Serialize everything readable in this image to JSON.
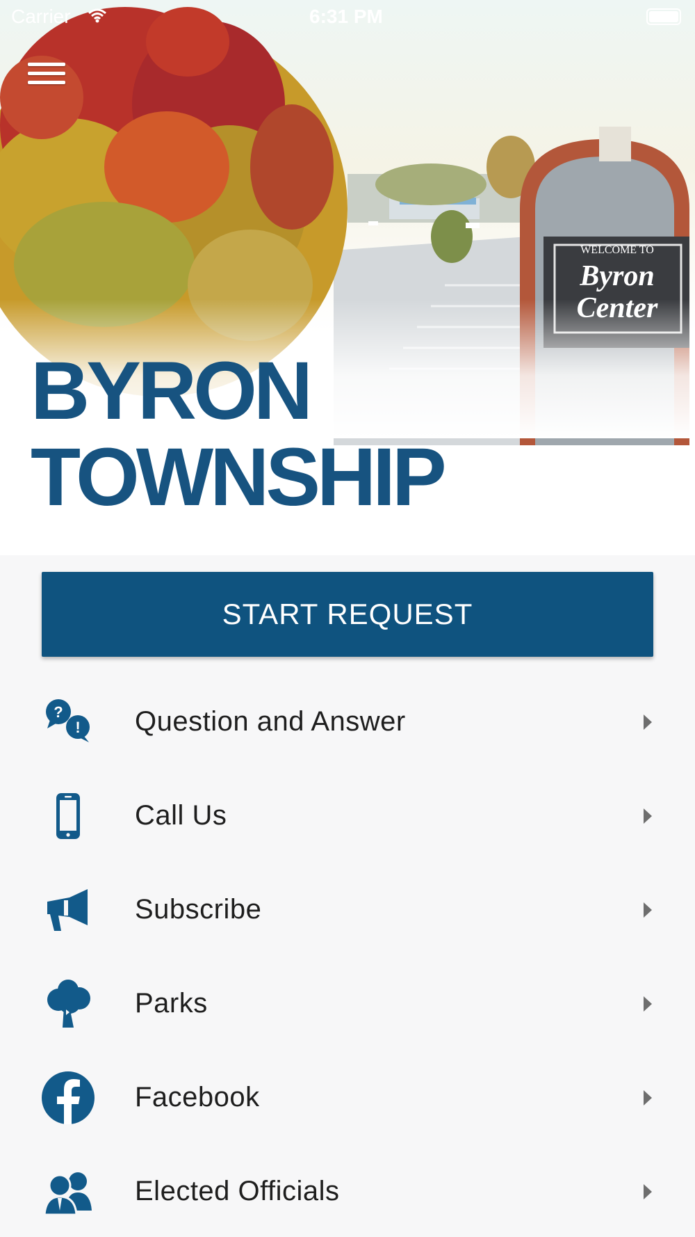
{
  "status_bar": {
    "carrier": "Carrier",
    "time": "6:31 PM"
  },
  "hero": {
    "title_line1": "BYRON",
    "title_line2": "TOWNSHIP",
    "sign_text_top": "WELCOME TO",
    "sign_text_main_1": "Byron",
    "sign_text_main_2": "Center"
  },
  "start_request": {
    "label": "START REQUEST"
  },
  "menu": {
    "items": [
      {
        "label": "Question and Answer",
        "icon": "question-answer-icon"
      },
      {
        "label": "Call Us",
        "icon": "phone-icon"
      },
      {
        "label": "Subscribe",
        "icon": "megaphone-icon"
      },
      {
        "label": "Parks",
        "icon": "tree-icon"
      },
      {
        "label": "Facebook",
        "icon": "facebook-icon"
      },
      {
        "label": "Elected Officials",
        "icon": "officials-icon"
      }
    ]
  },
  "colors": {
    "brand_blue": "#175380",
    "button_blue": "#0f537f",
    "icon_blue": "#125a8a",
    "background": "#f7f7f8"
  }
}
